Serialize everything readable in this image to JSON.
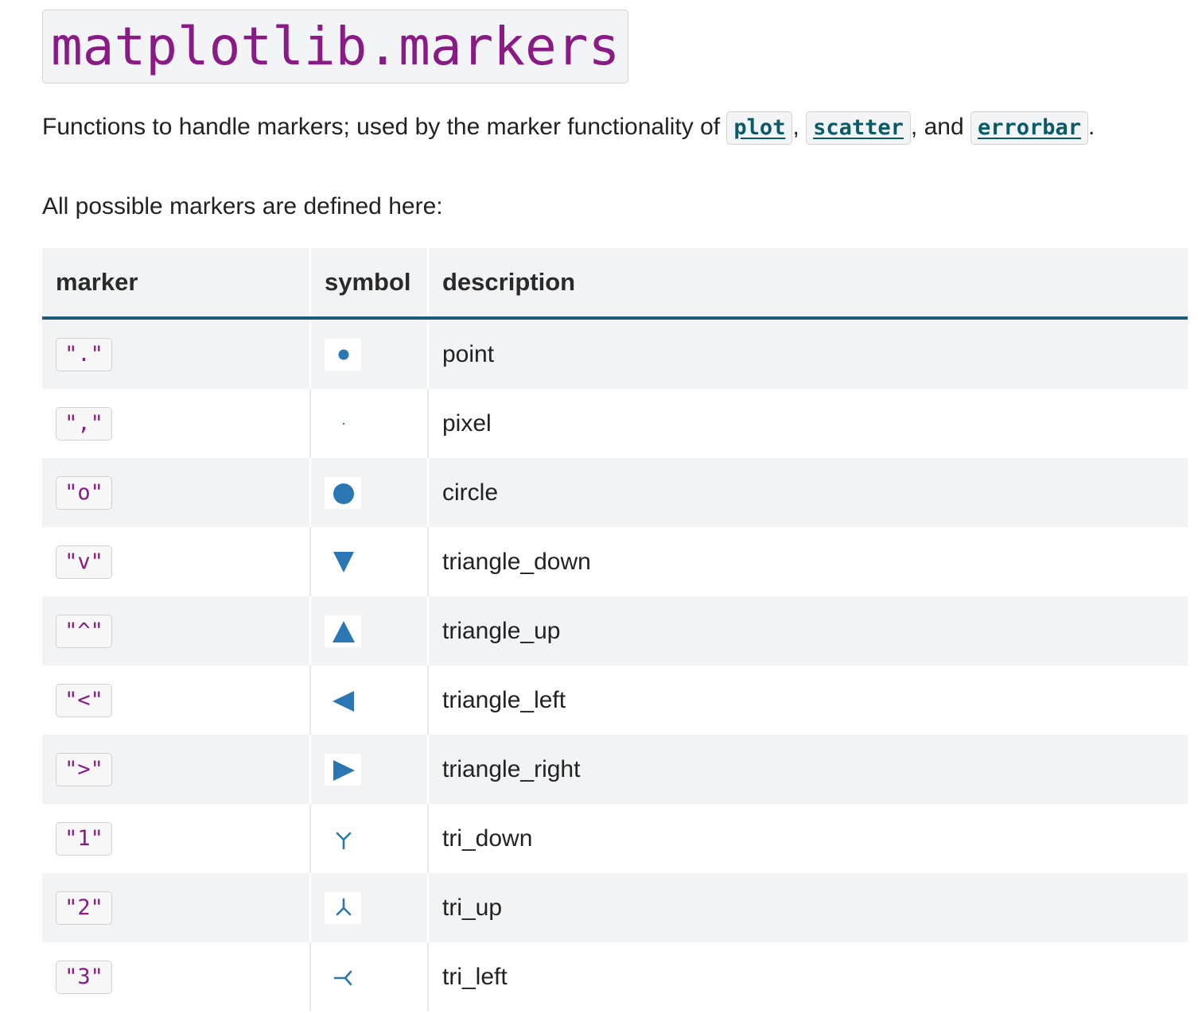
{
  "title": "matplotlib.markers",
  "intro": {
    "prefix": "Functions to handle markers; used by the marker functionality of ",
    "link1": "plot",
    "sep1": ", ",
    "link2": "scatter",
    "sep2": ", and ",
    "link3": "errorbar",
    "suffix": "."
  },
  "subtitle": "All possible markers are defined here:",
  "table": {
    "headers": {
      "marker": "marker",
      "symbol": "symbol",
      "description": "description"
    },
    "rows": [
      {
        "marker": "\".\"",
        "symbol_icon": "point-icon",
        "description": "point"
      },
      {
        "marker": "\",\"",
        "symbol_icon": "pixel-icon",
        "description": "pixel"
      },
      {
        "marker": "\"o\"",
        "symbol_icon": "circle-icon",
        "description": "circle"
      },
      {
        "marker": "\"v\"",
        "symbol_icon": "triangle-down-icon",
        "description": "triangle_down"
      },
      {
        "marker": "\"^\"",
        "symbol_icon": "triangle-up-icon",
        "description": "triangle_up"
      },
      {
        "marker": "\"<\"",
        "symbol_icon": "triangle-left-icon",
        "description": "triangle_left"
      },
      {
        "marker": "\">\"",
        "symbol_icon": "triangle-right-icon",
        "description": "triangle_right"
      },
      {
        "marker": "\"1\"",
        "symbol_icon": "tri-down-icon",
        "description": "tri_down"
      },
      {
        "marker": "\"2\"",
        "symbol_icon": "tri-up-icon",
        "description": "tri_up"
      },
      {
        "marker": "\"3\"",
        "symbol_icon": "tri-left-icon",
        "description": "tri_left"
      }
    ]
  },
  "colors": {
    "marker_blue": "#2a77b4",
    "code_purple": "#8a1a86",
    "link_teal": "#0b5a6a",
    "header_rule": "#1d5a7e"
  }
}
